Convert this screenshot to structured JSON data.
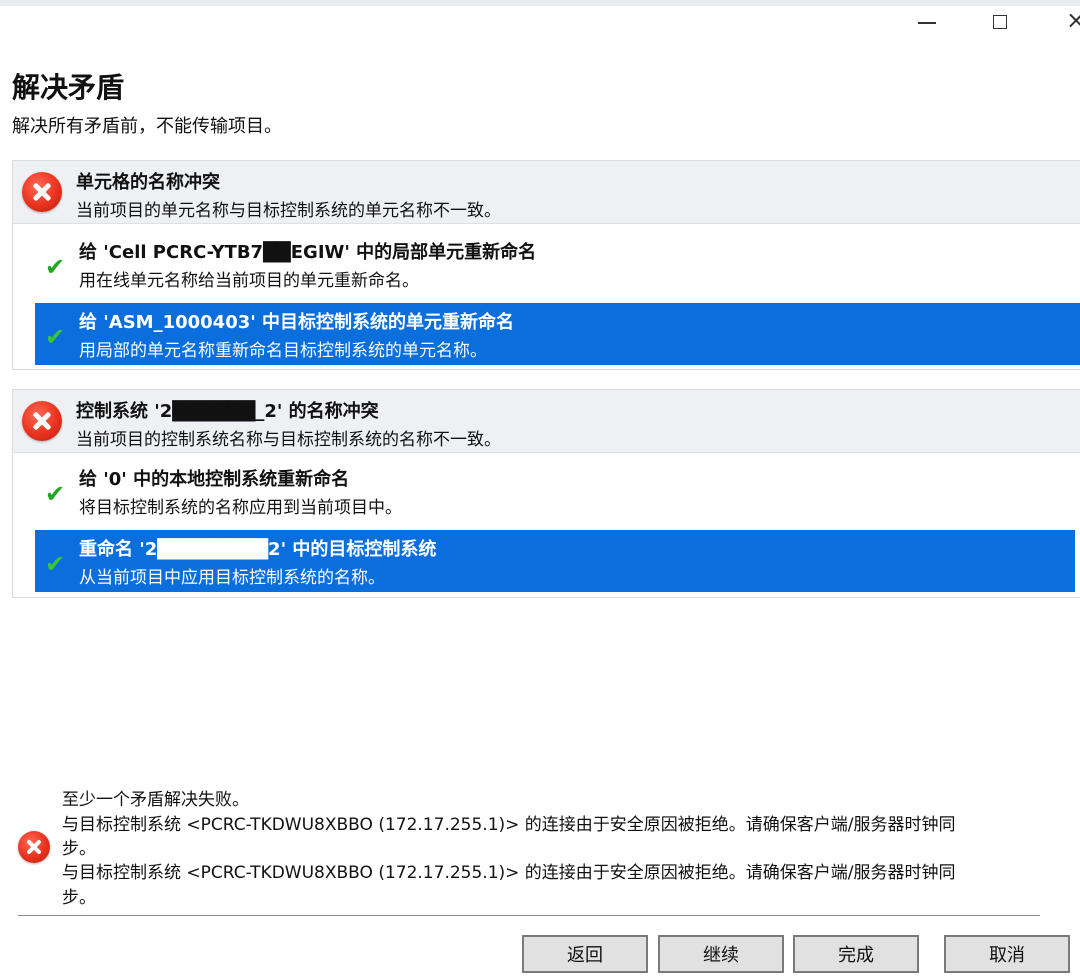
{
  "window": {
    "minimize_icon": "minimize-icon",
    "maximize_icon": "maximize-icon",
    "close_glyph": "×"
  },
  "page": {
    "title": "解决矛盾",
    "subtitle": "解决所有矛盾前，不能传输项目。"
  },
  "conflicts": [
    {
      "title": "单元格的名称冲突",
      "description": "当前项目的单元名称与目标控制系统的单元名称不一致。",
      "status_icon": "error-icon",
      "options": [
        {
          "title": "给 'Cell PCRC-YTB7██EGIW' 中的局部单元重新命名",
          "description": "用在线单元名称给当前项目的单元重新命名。",
          "selected": false
        },
        {
          "title": "给 'ASM_1000403' 中目标控制系统的单元重新命名",
          "description": "用局部的单元名称重新命名目标控制系统的单元名称。",
          "selected": true
        }
      ]
    },
    {
      "title": "控制系统 '2██████_2' 的名称冲突",
      "description": "当前项目的控制系统名称与目标控制系统的名称不一致。",
      "status_icon": "error-icon",
      "options": [
        {
          "title": "给 '0' 中的本地控制系统重新命名",
          "description": "将目标控制系统的名称应用到当前项目中。",
          "selected": false
        },
        {
          "title": "重命名 '2████████2' 中的目标控制系统",
          "description": "从当前项目中应用目标控制系统的名称。",
          "selected": true
        }
      ]
    }
  ],
  "footer": {
    "status_icon": "error-icon",
    "lines": [
      "至少一个矛盾解决失败。",
      "与目标控制系统 <PCRC-TKDWU8XBBO (172.17.255.1)> 的连接由于安全原因被拒绝。请确保客户端/服务器时钟同",
      "步。",
      "与目标控制系统 <PCRC-TKDWU8XBBO (172.17.255.1)> 的连接由于安全原因被拒绝。请确保客户端/服务器时钟同",
      "步。"
    ]
  },
  "buttons": {
    "back": "返回",
    "continue": "继续",
    "finish": "完成",
    "cancel": "取消"
  },
  "colors": {
    "selection": "#0a6fdc",
    "check": "#1fa81f",
    "error": "#e8321e"
  }
}
